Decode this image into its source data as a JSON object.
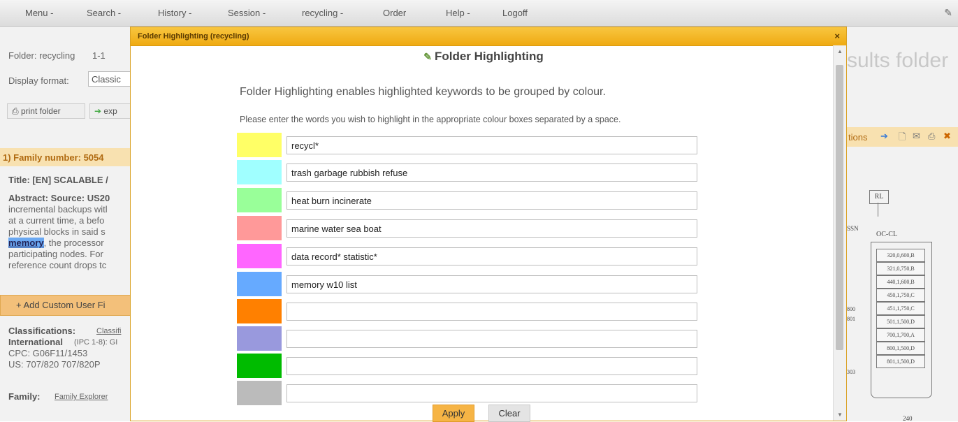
{
  "menu": {
    "items": [
      "Menu -",
      "Search -",
      "History -",
      "Session -",
      "recycling -",
      "Order",
      "Help -",
      "Logoff"
    ]
  },
  "background": {
    "folder_label": "Folder: recycling",
    "folder_range": "1-1",
    "display_format_label": "Display format:",
    "display_format_value": "Classic",
    "print_folder": "print folder",
    "export": "exp",
    "family_number": "1) Family number: 5054",
    "title_line": "Title: [EN] SCALABLE /",
    "abstract_lines": [
      "Abstract: Source: US20",
      "incremental backups witl",
      "at a current time, a befo",
      "physical blocks in said s",
      "memory",
      ", the processor",
      "participating nodes. For",
      "reference count drops tc"
    ],
    "add_custom": "+ Add Custom User Fi",
    "classifications": "Classifications:",
    "classif_link": "Classifi",
    "international": "International",
    "international_sub": "(IPC 1-8): GI",
    "cpc": "CPC: G06F11/1453",
    "us": "US: 707/820 707/820P",
    "family": "Family:",
    "family_link": "Family Explorer",
    "results_folder": "sults folder",
    "options": "tions",
    "diagram": {
      "rl": "RL",
      "occl": "OC-CL",
      "ssn": "SSN",
      "cells": [
        "320,0,600,B",
        "321,0,750,B",
        "440,1,600,B",
        "450,1,750,C",
        "451,1,750,C",
        "501,1,500,D",
        "700,1,700,A",
        "800,1,500,D",
        "801,1,500,D"
      ],
      "left_nums": [
        "800",
        "801",
        "303"
      ],
      "bottom": "240"
    }
  },
  "modal": {
    "title": "Folder Highlighting (recycling)",
    "close": "×",
    "heading": "Folder Highlighting",
    "intro": "Folder Highlighting enables highlighted keywords to be grouped by colour.",
    "instructions": "Please enter the words you wish to highlight in the appropriate colour boxes separated by a space.",
    "rows": [
      {
        "color": "#ffff66",
        "value": "recycl*"
      },
      {
        "color": "#a0ffff",
        "value": "trash garbage rubbish refuse"
      },
      {
        "color": "#99ff99",
        "value": "heat burn incinerate"
      },
      {
        "color": "#ff9999",
        "value": "marine water sea boat"
      },
      {
        "color": "#ff66ff",
        "value": "data record* statistic*"
      },
      {
        "color": "#66aaff",
        "value": "memory w10 list"
      },
      {
        "color": "#ff8000",
        "value": ""
      },
      {
        "color": "#9999dd",
        "value": ""
      },
      {
        "color": "#00bb00",
        "value": ""
      },
      {
        "color": "#bbbbbb",
        "value": ""
      }
    ],
    "apply": "Apply",
    "clear": "Clear"
  }
}
